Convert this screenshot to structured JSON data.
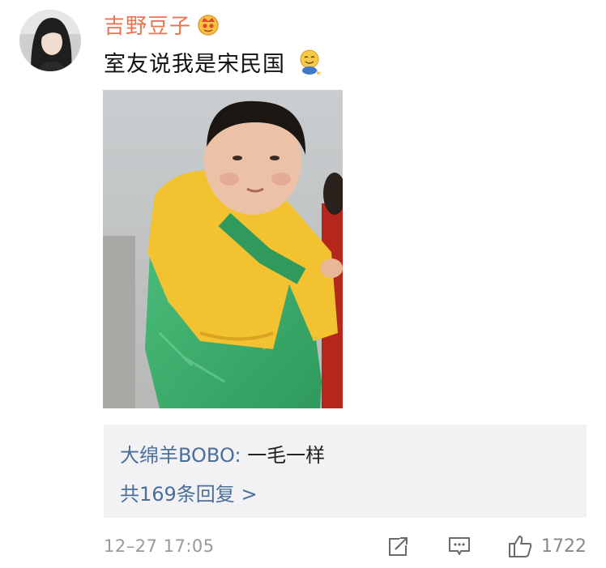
{
  "user": {
    "name": "吉野豆子",
    "badge_icon": "crown-badge-icon"
  },
  "comment": {
    "text": "室友说我是宋民国",
    "emoji_icon": "smiling-face-emoji"
  },
  "reply": {
    "author": "大绵羊BOBO",
    "separator": ":",
    "text": "一毛一样",
    "count_label": "共169条回复",
    "count_arrow": ">"
  },
  "footer": {
    "timestamp": "12–27 17:05",
    "like_count": "1722"
  },
  "colors": {
    "username": "#eb7350",
    "link": "#4a6f9c",
    "reply_bg": "#f2f2f4",
    "meta": "#9a9a9a"
  }
}
